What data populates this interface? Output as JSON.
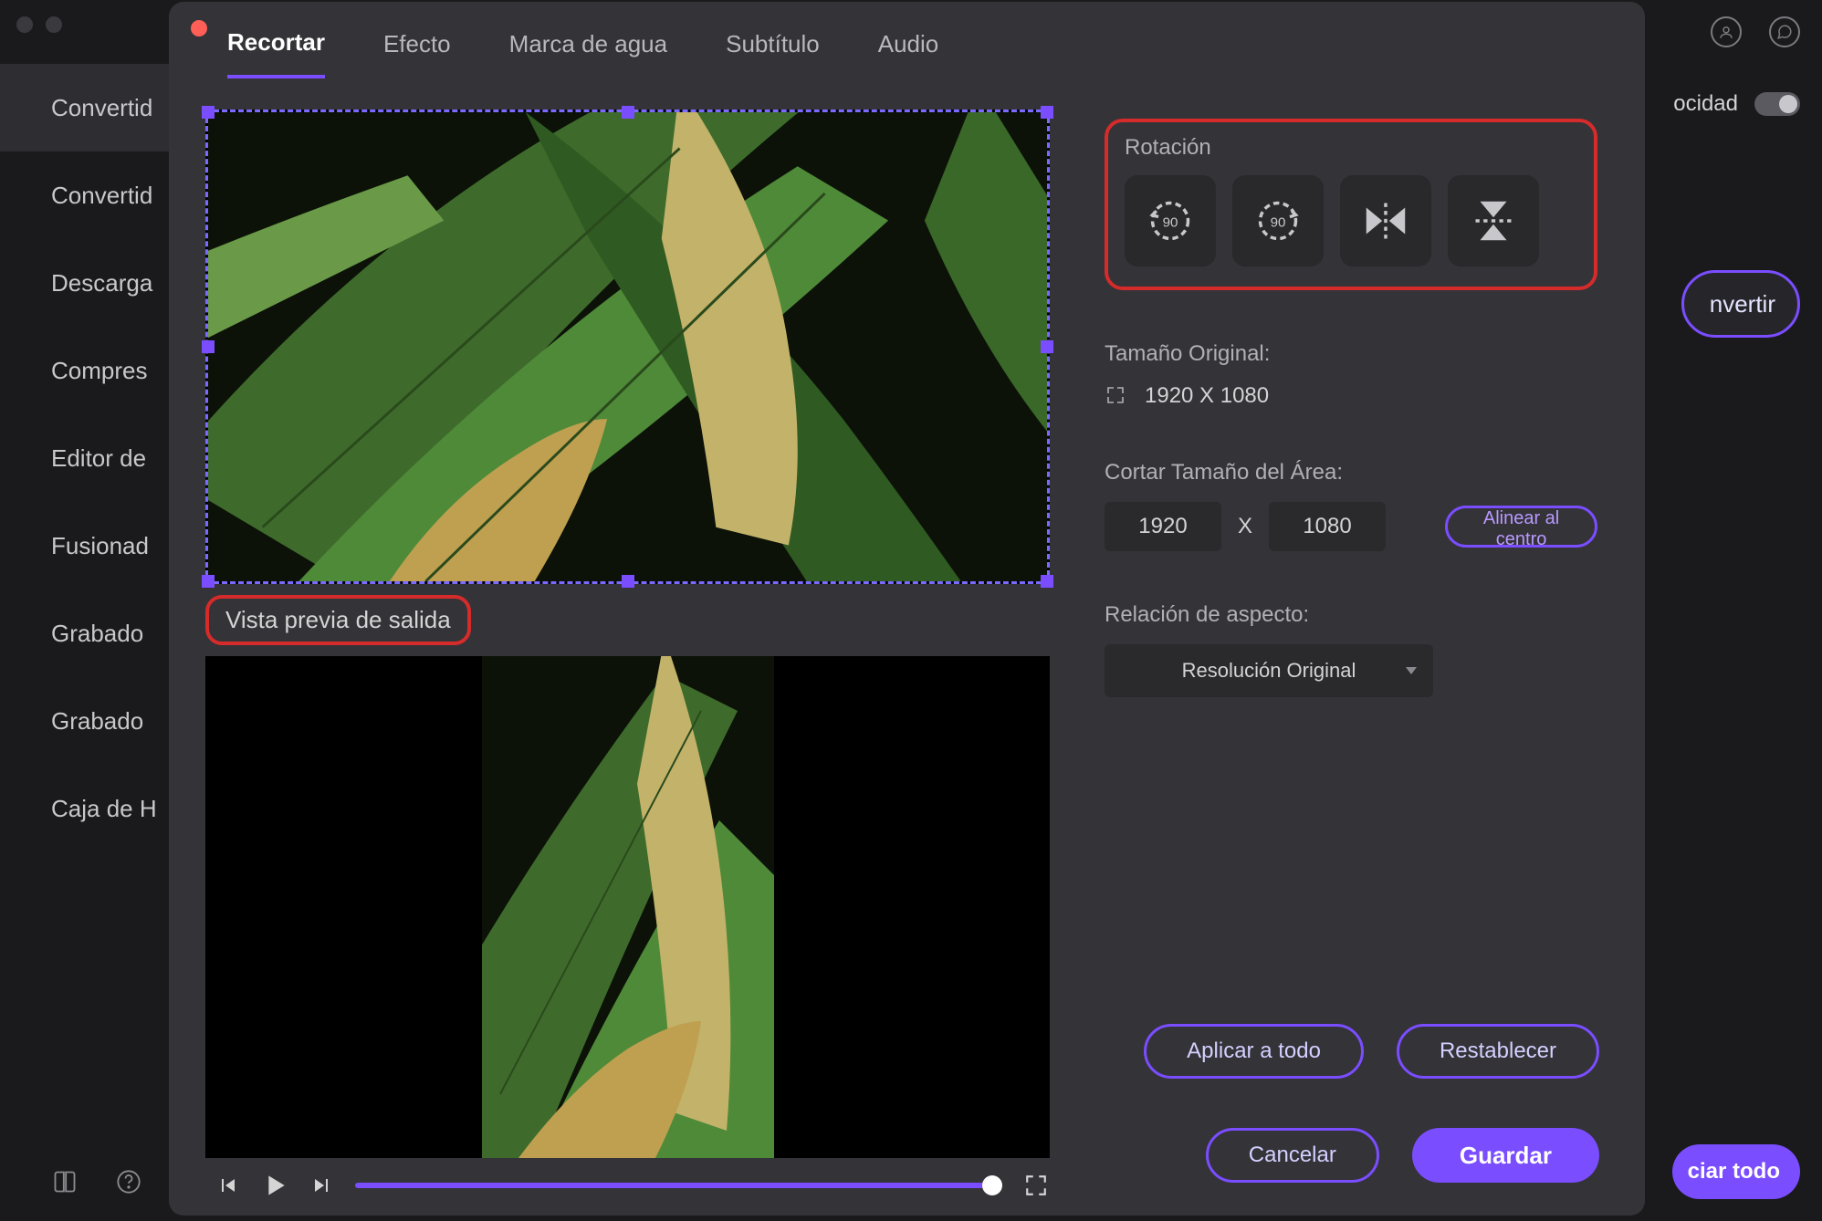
{
  "topbar": {
    "speed_partial": "ocidad"
  },
  "bg_buttons": {
    "convert_partial": "nvertir",
    "start_all_partial": "ciar todo"
  },
  "sidebar": {
    "items": [
      {
        "label": "Convertid"
      },
      {
        "label": "Convertid"
      },
      {
        "label": "Descarga"
      },
      {
        "label": "Compres"
      },
      {
        "label": "Editor de"
      },
      {
        "label": "Fusionad"
      },
      {
        "label": "Grabado"
      },
      {
        "label": "Grabado"
      },
      {
        "label": "Caja de H"
      }
    ]
  },
  "dialog": {
    "tabs": [
      {
        "label": "Recortar",
        "active": true
      },
      {
        "label": "Efecto"
      },
      {
        "label": "Marca de agua"
      },
      {
        "label": "Subtítulo"
      },
      {
        "label": "Audio"
      }
    ],
    "preview_label": "Vista previa de salida",
    "rotation": {
      "label": "Rotación"
    },
    "original_size": {
      "label": "Tamaño Original:",
      "value": "1920 X 1080"
    },
    "crop_area": {
      "label": "Cortar Tamaño del Área:",
      "width": "1920",
      "sep": "X",
      "height": "1080",
      "align_center": "Alinear al centro"
    },
    "aspect": {
      "label": "Relación de aspecto:",
      "selected": "Resolución Original"
    },
    "buttons": {
      "apply_all": "Aplicar a todo",
      "reset": "Restablecer",
      "cancel": "Cancelar",
      "save": "Guardar"
    }
  }
}
